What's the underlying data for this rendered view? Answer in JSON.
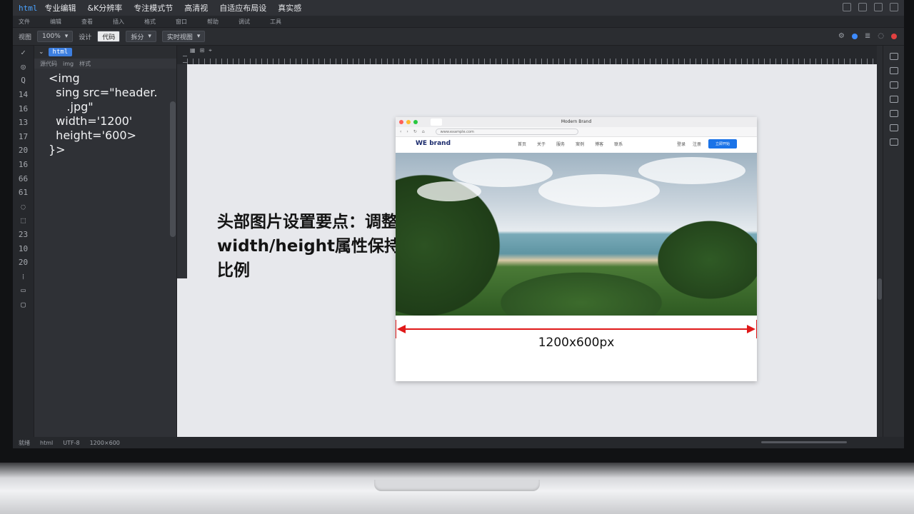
{
  "menubar": {
    "app_badge": "html",
    "items": [
      "专业编辑",
      "&K分辨率",
      "专注模式节",
      "高清视",
      "自适应布局设",
      "真实感"
    ]
  },
  "toolbar1": {
    "items": [
      "文件",
      "编辑",
      "查看",
      "插入",
      "格式",
      "窗口",
      "帮助",
      "调试",
      "工具"
    ]
  },
  "toolbar2": {
    "label_a": "视图",
    "select_a": "100%",
    "label_b": "设计",
    "label_c": "代码",
    "select_c": "拆分",
    "select_d": "实时视图"
  },
  "gutter": {
    "rows": [
      "✓",
      "◎",
      "Q",
      "14",
      "16",
      "13",
      "17",
      "20",
      "16",
      "66",
      "61",
      "◌",
      "⬚",
      "23",
      "10",
      "20",
      "⁞",
      "▭",
      "▢"
    ]
  },
  "code_pane": {
    "tab_label": "html",
    "breadcrumb": [
      "源代码",
      "img",
      "样式"
    ],
    "lines": [
      "<img",
      "  sing src=\"header.",
      "     .jpg\"",
      "",
      "  width='1200'",
      "  height='600>",
      "}>"
    ]
  },
  "canvas": {
    "callout": "头部图片设置要点：调整width/height属性保持比例",
    "mock": {
      "window_title": "Modern Brand",
      "url": "www.example.com",
      "logo": "WE brand",
      "nav": [
        "首页",
        "关于",
        "服务",
        "案例",
        "博客",
        "联系"
      ],
      "nav_right": [
        "登录",
        "注册"
      ],
      "cta": "立即开始"
    },
    "dimension_label": "1200x600px"
  },
  "statusbar": {
    "items": [
      "就绪",
      "html",
      "UTF-8",
      "1200×600"
    ]
  },
  "colors": {
    "accent": "#1a73e8",
    "dimension": "#e01919",
    "code_tag": "#f08c8c"
  }
}
